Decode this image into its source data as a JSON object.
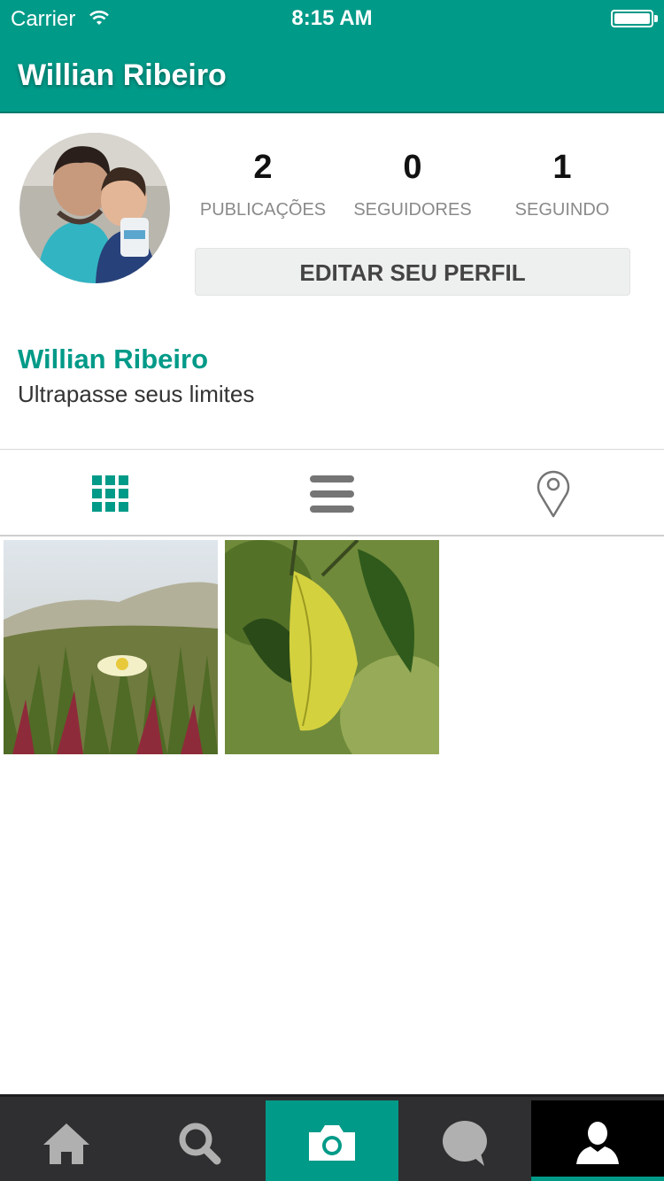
{
  "status_bar": {
    "carrier": "Carrier",
    "time": "8:15 AM"
  },
  "nav": {
    "title": "Willian Ribeiro"
  },
  "profile": {
    "stats": [
      {
        "value": "2",
        "label": "PUBLICAÇÕES"
      },
      {
        "value": "0",
        "label": "SEGUIDORES"
      },
      {
        "value": "1",
        "label": "SEGUINDO"
      }
    ],
    "edit_button": "EDITAR SEU PERFIL",
    "name": "Willian Ribeiro",
    "bio": "Ultrapasse seus limites"
  },
  "view_tabs": [
    {
      "icon": "grid-icon",
      "active": true
    },
    {
      "icon": "list-icon",
      "active": false
    },
    {
      "icon": "map-pin-icon",
      "active": false
    }
  ],
  "photos": [
    {
      "subject": "flower-in-dunes"
    },
    {
      "subject": "yellow-leaf"
    }
  ],
  "tab_bar": [
    {
      "icon": "home-icon",
      "active": false
    },
    {
      "icon": "search-icon",
      "active": false
    },
    {
      "icon": "camera-icon",
      "active": true
    },
    {
      "icon": "chat-bubble-icon",
      "active": false
    },
    {
      "icon": "profile-icon",
      "active": true
    }
  ],
  "colors": {
    "accent": "#009a88",
    "tab_bar": "#2f2f31",
    "icon_inactive": "#b0b0b0"
  }
}
